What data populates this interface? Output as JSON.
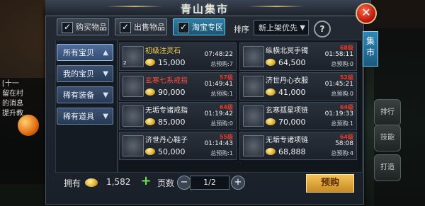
{
  "window": {
    "title": "青山集市"
  },
  "top_tabs": [
    {
      "label": "购买物品",
      "active": false
    },
    {
      "label": "出售物品",
      "active": false
    },
    {
      "label": "淘宝专区",
      "active": true
    }
  ],
  "sort": {
    "label": "排序",
    "value": "新上架优先"
  },
  "side_tab": {
    "label": "集市"
  },
  "categories": [
    {
      "label": "所有宝贝",
      "active": true
    },
    {
      "label": "我的宝贝",
      "active": false
    },
    {
      "label": "稀有装备",
      "active": false
    },
    {
      "label": "稀有道具",
      "active": false
    }
  ],
  "items": [
    {
      "name": "初级注灵石",
      "name_color": "#ffd24a",
      "qty": "2",
      "price": "15,000",
      "flag": "",
      "time": "07:48:22",
      "bids": "总预购:7",
      "icon": "green-gem-icon"
    },
    {
      "name": "纵横北冥手镯",
      "name_color": "#f2f2f2",
      "qty": "",
      "price": "64,500",
      "flag": "68级",
      "time": "01:58:11",
      "bids": "总预购:0",
      "icon": "bracelet-icon"
    },
    {
      "name": "玄寒七系戒指",
      "name_color": "#ff4b3a",
      "qty": "",
      "price": "90,000",
      "flag": "57级",
      "time": "01:49:41",
      "bids": "总预购:1",
      "icon": "ring-icon"
    },
    {
      "name": "济世丹心衣服",
      "name_color": "#f2f2f2",
      "qty": "",
      "price": "41,000",
      "flag": "52级",
      "time": "01:45:21",
      "bids": "总预购:0",
      "icon": "robe-icon"
    },
    {
      "name": "无垢专诸戒指",
      "name_color": "#f2f2f2",
      "qty": "",
      "price": "85,000",
      "flag": "64级",
      "time": "01:19:42",
      "bids": "总预购:0",
      "icon": "gauntlet-ring-icon"
    },
    {
      "name": "玄寒孤星项链",
      "name_color": "#f2f2f2",
      "qty": "",
      "price": "70,000",
      "flag": "64级",
      "time": "01:19:33",
      "bids": "总预购:1",
      "icon": "necklace-icon"
    },
    {
      "name": "济世丹心鞋子",
      "name_color": "#f2f2f2",
      "qty": "",
      "price": "50,000",
      "flag": "55级",
      "time": "01:14:43",
      "bids": "总预购:1",
      "icon": "boots-icon"
    },
    {
      "name": "无垢专诸项链",
      "name_color": "#f2f2f2",
      "qty": "",
      "price": "68,888",
      "flag": "64级",
      "time": "58:08",
      "bids": "总预购:4",
      "icon": "chain-necklace-icon"
    }
  ],
  "footer": {
    "own_label": "拥有",
    "own_value": "1,582",
    "page_label": "页数",
    "page_value": "1/2",
    "buy_label": "预购"
  },
  "background": {
    "left_text": "[十一\n留在村\n的消息\n提升教",
    "right_labels": [
      "排行",
      "技能",
      "打造"
    ]
  }
}
